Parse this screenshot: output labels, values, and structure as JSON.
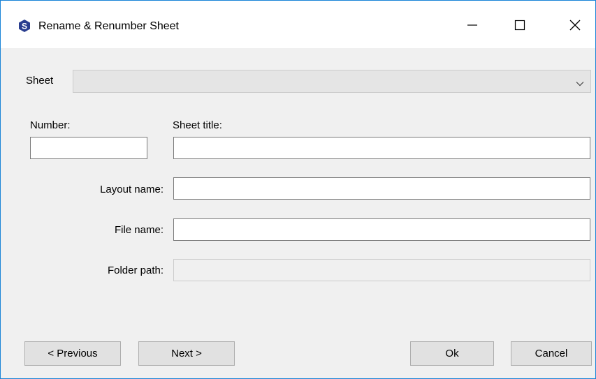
{
  "window": {
    "title": "Rename & Renumber Sheet",
    "icon": "app-logo-icon",
    "accent_color": "#1883d7"
  },
  "controls": {
    "minimize_icon": "minimize-icon",
    "maximize_icon": "maximize-icon",
    "close_icon": "close-icon"
  },
  "form": {
    "sheet_label": "Sheet",
    "sheet_value": "",
    "number_label": "Number:",
    "number_value": "",
    "sheet_title_label": "Sheet title:",
    "sheet_title_value": "",
    "layout_name_label": "Layout name:",
    "layout_name_value": "",
    "file_name_label": "File name:",
    "file_name_value": "",
    "folder_path_label": "Folder path:",
    "folder_path_value": ""
  },
  "buttons": {
    "previous": "< Previous",
    "next": "Next >",
    "ok": "Ok",
    "cancel": "Cancel"
  }
}
